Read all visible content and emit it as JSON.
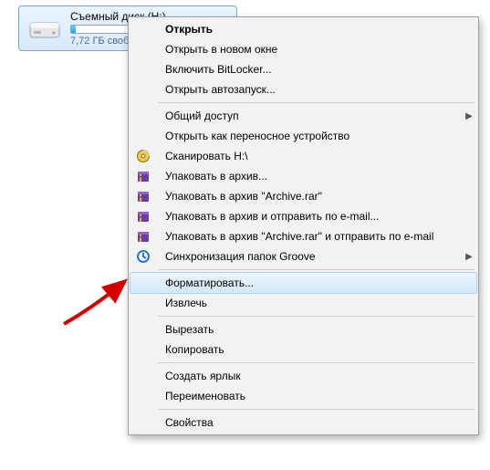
{
  "drive": {
    "title": "Съемный диск (H:)",
    "free_text": "7,72 ГБ своб",
    "progress_percent": 3
  },
  "menu": {
    "items": [
      {
        "label": "Открыть",
        "icon": null,
        "bold": true
      },
      {
        "label": "Открыть в новом окне",
        "icon": null
      },
      {
        "label": "Включить BitLocker...",
        "icon": null
      },
      {
        "label": "Открыть автозапуск...",
        "icon": null
      },
      {
        "sep": true
      },
      {
        "label": "Общий доступ",
        "icon": null,
        "submenu": true
      },
      {
        "label": "Открыть как переносное устройство",
        "icon": null
      },
      {
        "label": "Сканировать H:\\",
        "icon": "winrar-disc"
      },
      {
        "label": "Упаковать в архив...",
        "icon": "winrar"
      },
      {
        "label": "Упаковать в архив \"Archive.rar\"",
        "icon": "winrar"
      },
      {
        "label": "Упаковать в архив и отправить по e-mail...",
        "icon": "winrar"
      },
      {
        "label": "Упаковать в архив \"Archive.rar\" и отправить по e-mail",
        "icon": "winrar"
      },
      {
        "label": "Синхронизация папок Groove",
        "icon": "groove",
        "submenu": true
      },
      {
        "sep": true
      },
      {
        "label": "Форматировать...",
        "icon": null,
        "highlight": true
      },
      {
        "label": "Извлечь",
        "icon": null
      },
      {
        "sep": true
      },
      {
        "label": "Вырезать",
        "icon": null
      },
      {
        "label": "Копировать",
        "icon": null
      },
      {
        "sep": true
      },
      {
        "label": "Создать ярлык",
        "icon": null
      },
      {
        "label": "Переименовать",
        "icon": null
      },
      {
        "sep": true
      },
      {
        "label": "Свойства",
        "icon": null
      }
    ]
  },
  "icons": {
    "winrar": "winrar-icon",
    "winrar-disc": "winrar-disc-icon",
    "groove": "groove-icon"
  }
}
